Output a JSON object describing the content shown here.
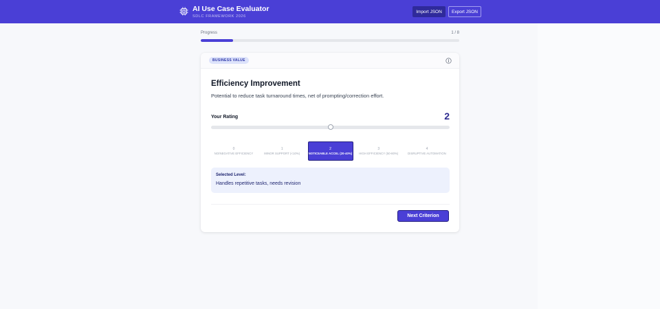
{
  "app": {
    "title": "AI Use Case Evaluator",
    "subtitle": "SDLC FRAMEWORK 2026",
    "import_label": "Import JSON",
    "export_label": "Export JSON",
    "brand_icon": "chip-icon",
    "accent_color": "#4a3fd6"
  },
  "progress": {
    "label": "Progress",
    "count": "1 / 8",
    "fraction": 0.125
  },
  "criterion": {
    "category": "BUSINESS VALUE",
    "info_icon": "info-icon",
    "title": "Efficiency Improvement",
    "description": "Potential to reduce task turnaround times, net of prompting/correction effort.",
    "rating_label": "Your Rating",
    "rating_value": "2",
    "rating": 2,
    "rating_max": 4,
    "levels": [
      {
        "num": "0",
        "label": "NO/NEGATIVE EFFICIENCY"
      },
      {
        "num": "1",
        "label": "MINOR SUPPORT (<10%)"
      },
      {
        "num": "2",
        "label": "NOTICEABLE ACCEL (20-40%)"
      },
      {
        "num": "3",
        "label": "HIGH EFFICIENCY (50-80%)"
      },
      {
        "num": "4",
        "label": "DISRUPTIVE AUTOMATION"
      }
    ],
    "selected_title": "Selected Level:",
    "selected_text": "Handles repetitive tasks, needs revision",
    "next_label": "Next Criterion"
  }
}
